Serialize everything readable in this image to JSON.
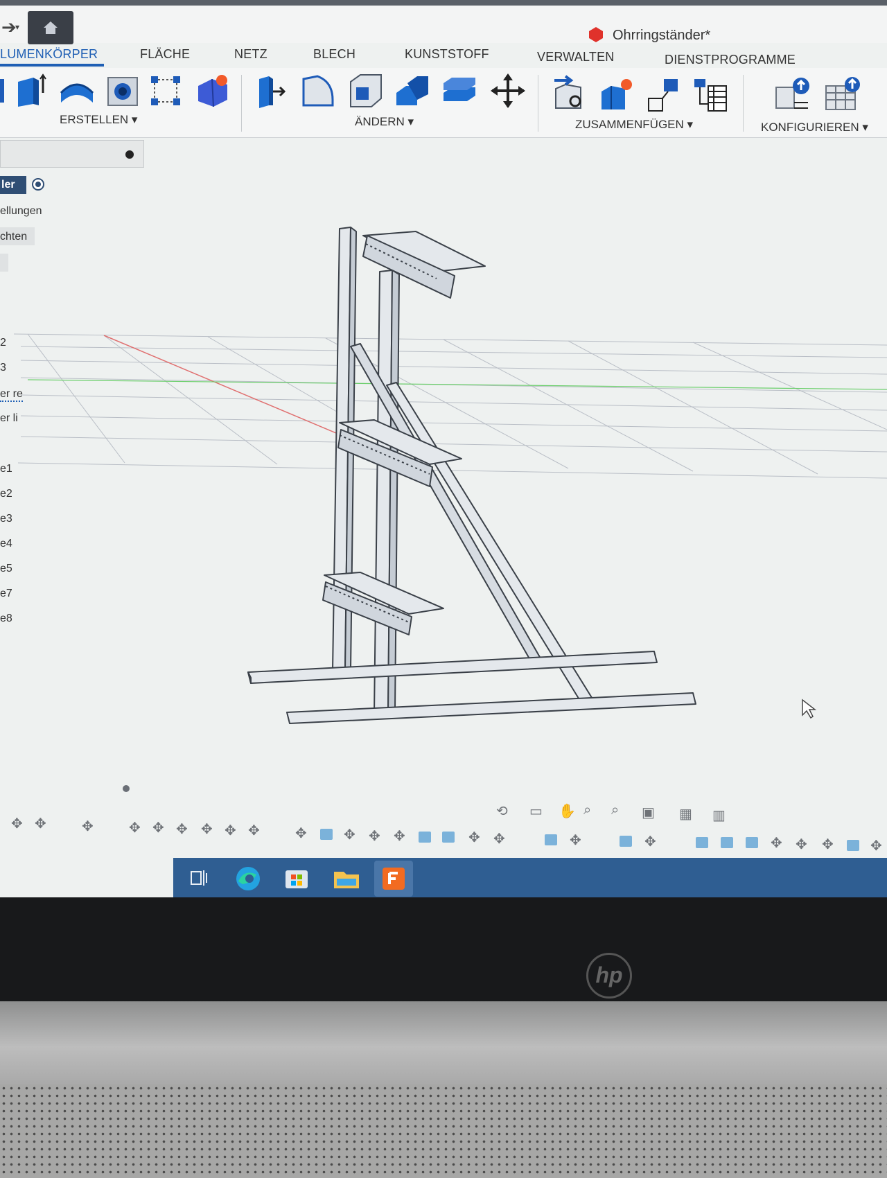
{
  "window": {
    "title": "Ohrringständer*"
  },
  "tabs": [
    {
      "label": "LUMENKÖRPER",
      "active": true
    },
    {
      "label": "FLÄCHE"
    },
    {
      "label": "NETZ"
    },
    {
      "label": "BLECH"
    },
    {
      "label": "KUNSTSTOFF"
    },
    {
      "label": "VERWALTEN"
    },
    {
      "label": "DIENSTPROGRAMME"
    }
  ],
  "toolbar": {
    "groups": [
      {
        "label": "ERSTELLEN ▾"
      },
      {
        "label": "ÄNDERN ▾"
      },
      {
        "label": "ZUSAMMENFÜGEN ▾"
      },
      {
        "label": "KONFIGURIEREN ▾"
      }
    ]
  },
  "browser": {
    "active_tab": "ler",
    "items": [
      "ellungen",
      "chten",
      "er re",
      "er li",
      "e1",
      "e2",
      "e3",
      "e4",
      "e5",
      "e7",
      "e8"
    ],
    "digits": [
      "2",
      "3"
    ]
  },
  "colors": {
    "accent": "#1f5fb4",
    "x_axis": "#e07070",
    "y_axis": "#6ccf6c",
    "taskbar": "#2f5e92",
    "fusion_orange": "#f26b21"
  },
  "icons": [
    "home-icon",
    "extrude-icon",
    "revolve-icon",
    "hole-icon",
    "pattern-icon",
    "create-form-icon",
    "press-pull-icon",
    "fillet-icon",
    "shell-icon",
    "combine-icon",
    "offset-face-icon",
    "move-icon",
    "joint-icon",
    "new-component-icon",
    "rigid-group-icon",
    "bom-icon",
    "parameters-icon",
    "configure-table-icon"
  ],
  "taskbar": [
    "task-view-icon",
    "edge-icon",
    "store-icon",
    "file-explorer-icon",
    "fusion-360-icon"
  ]
}
